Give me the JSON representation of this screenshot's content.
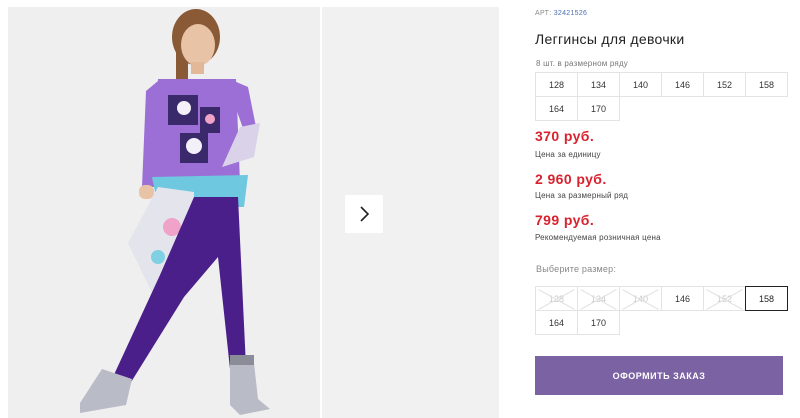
{
  "product": {
    "art_label": "АРТ:",
    "art_value": "32421526",
    "title": "Леггинсы для девочки",
    "row_note": "8 шт. в размерном ряду",
    "row_sizes": [
      "128",
      "134",
      "140",
      "146",
      "152",
      "158",
      "164",
      "170"
    ]
  },
  "prices": [
    {
      "value": "370 руб.",
      "note": "Цена за единицу"
    },
    {
      "value": "2 960 руб.",
      "note": "Цена за размерный ряд"
    },
    {
      "value": "799 руб.",
      "note": "Рекомендуемая розничная цена"
    }
  ],
  "size_picker": {
    "label": "Выберите размер:",
    "options": [
      {
        "size": "128",
        "available": false
      },
      {
        "size": "134",
        "available": false
      },
      {
        "size": "140",
        "available": false
      },
      {
        "size": "146",
        "available": true
      },
      {
        "size": "152",
        "available": false
      },
      {
        "size": "158",
        "available": true,
        "selected": true
      },
      {
        "size": "164",
        "available": true
      },
      {
        "size": "170",
        "available": true
      }
    ]
  },
  "order_button": "ОФОРМИТЬ ЗАКАЗ",
  "gallery": {
    "next_icon": "chevron-right-icon"
  },
  "colors": {
    "price": "#d8222e",
    "order_button": "#7a62a3",
    "shirt": "#9b6fd6",
    "leggings": "#4a1f8a"
  }
}
